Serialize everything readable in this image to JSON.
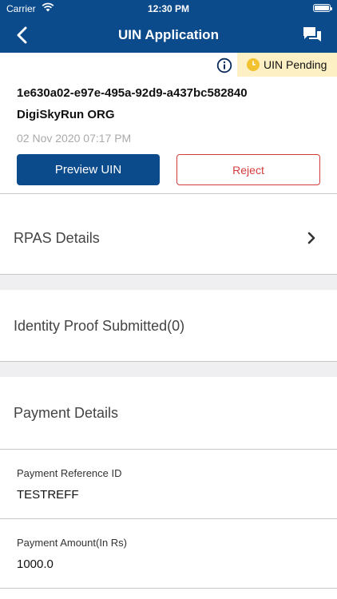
{
  "status_bar": {
    "carrier": "Carrier",
    "time": "12:30 PM"
  },
  "header": {
    "title": "UIN Application"
  },
  "status_badge": {
    "label": "UIN Pending"
  },
  "application": {
    "id": "1e630a02-e97e-495a-92d9-a437bc582840",
    "organization": "DigiSkyRun ORG",
    "date": "02 Nov 2020 07:17 PM"
  },
  "actions": {
    "preview_label": "Preview UIN",
    "reject_label": "Reject"
  },
  "sections": {
    "rpas": "RPAS Details",
    "identity": "Identity Proof Submitted(0)",
    "payment": "Payment Details"
  },
  "payment": {
    "reference_label": "Payment Reference ID",
    "reference_value": "TESTREFF",
    "amount_label": "Payment Amount(In Rs)",
    "amount_value": "1000.0"
  },
  "colors": {
    "brand": "#0b4a8b",
    "reject": "#d33c3c",
    "badge_bg": "#fdf0c4",
    "badge_icon": "#f2c230"
  }
}
